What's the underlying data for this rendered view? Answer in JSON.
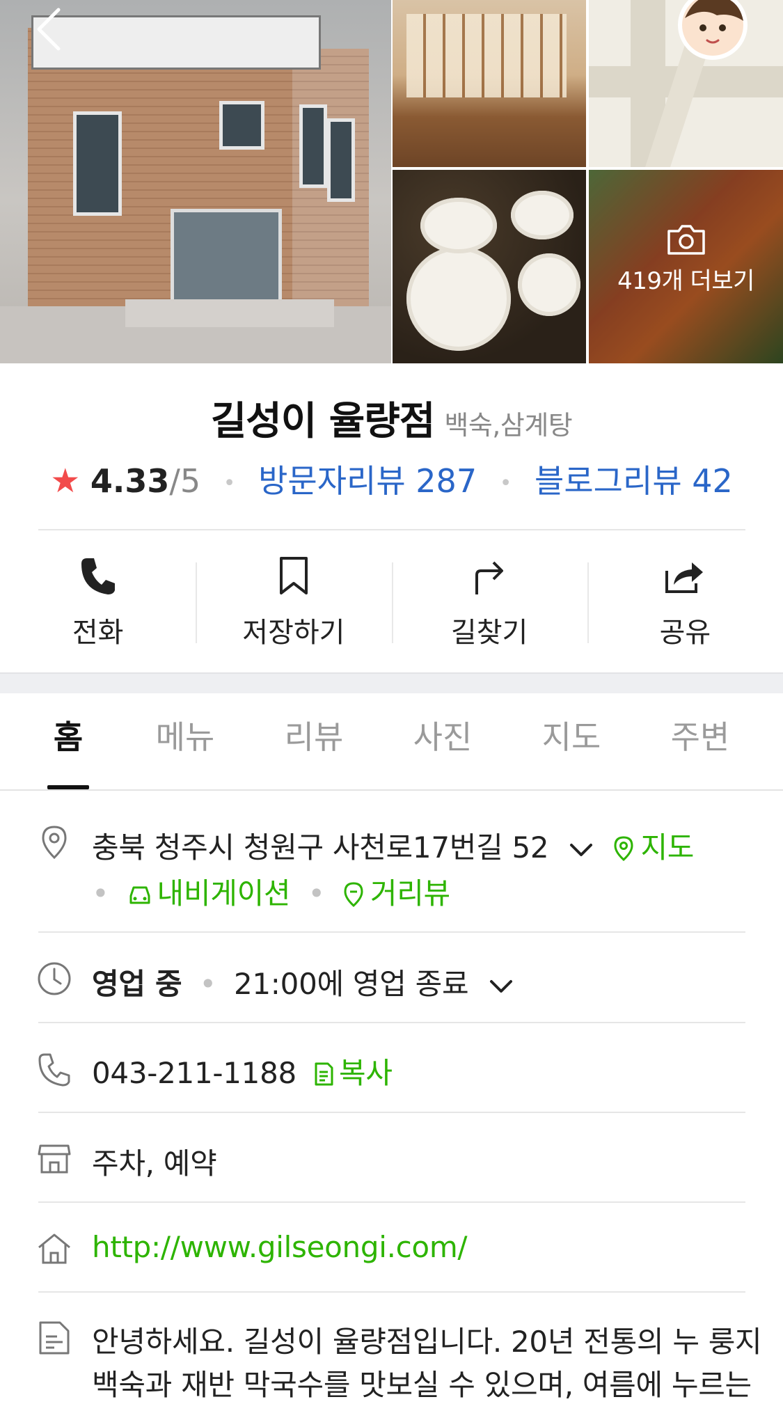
{
  "gallery": {
    "more_photos_label": "419개 더보기"
  },
  "place": {
    "name": "길성이 율량점",
    "category": "백숙,삼계탕",
    "rating": "4.33",
    "rating_max": "/5",
    "visitor_reviews": "방문자리뷰 287",
    "blog_reviews": "블로그리뷰 42"
  },
  "actions": [
    {
      "label": "전화"
    },
    {
      "label": "저장하기"
    },
    {
      "label": "길찾기"
    },
    {
      "label": "공유"
    }
  ],
  "tabs": [
    {
      "label": "홈"
    },
    {
      "label": "메뉴"
    },
    {
      "label": "리뷰"
    },
    {
      "label": "사진"
    },
    {
      "label": "지도"
    },
    {
      "label": "주변"
    }
  ],
  "info": {
    "address": "충북 청주시 청원구 사천로17번길 52",
    "map_link": "지도",
    "navigation_link": "내비게이션",
    "streetview_link": "거리뷰",
    "status": "영업 중",
    "hours": "21:00에 영업 종료",
    "phone": "043-211-1188",
    "copy_label": "복사",
    "amenities": "주차, 예약",
    "website": "http://www.gilseongi.com/",
    "description_line1": "안녕하세요. 길성이 율량점입니다. 20년 전통의 누 룽지",
    "description_line2": "백숙과 재반 막국수를 맛보실 수 있으며, 여름에 누르는"
  },
  "colors": {
    "link_blue": "#2a66c8",
    "link_green": "#2db400",
    "star_red": "#f24b4b"
  }
}
